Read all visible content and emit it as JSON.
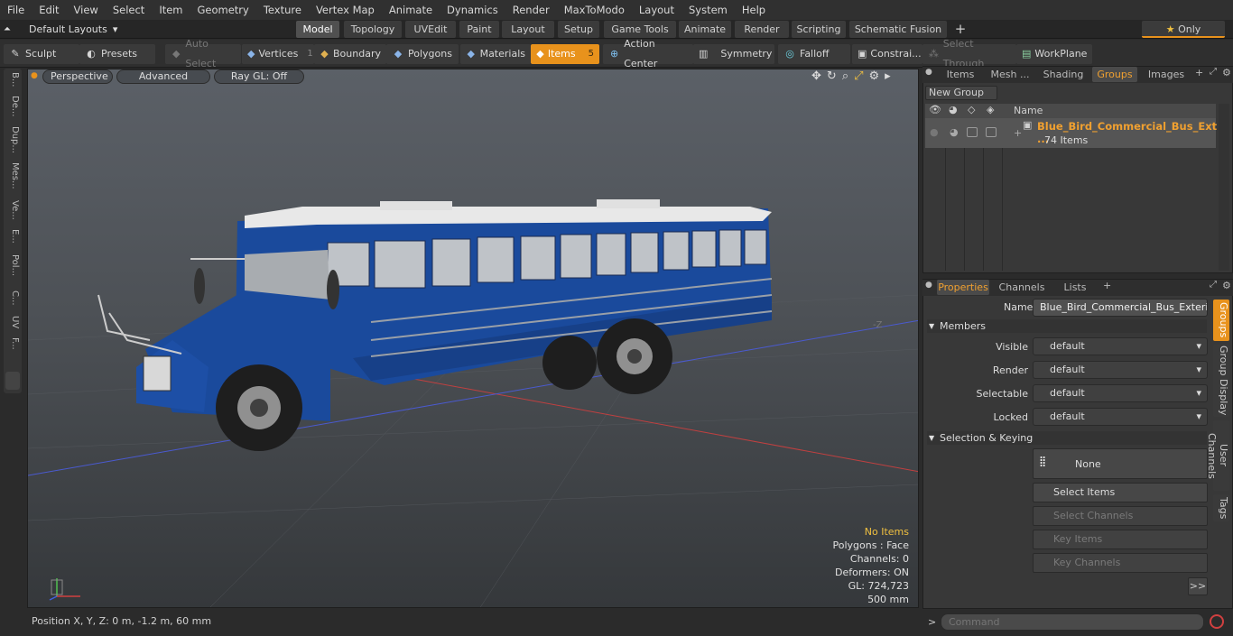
{
  "menu": [
    "File",
    "Edit",
    "View",
    "Select",
    "Item",
    "Geometry",
    "Texture",
    "Vertex Map",
    "Animate",
    "Dynamics",
    "Render",
    "MaxToModo",
    "Layout",
    "System",
    "Help"
  ],
  "tabbar": {
    "layouts_label": "Default Layouts",
    "tabs": [
      "Model",
      "Topology",
      "UVEdit",
      "Paint",
      "Layout",
      "Setup",
      "Game Tools",
      "Animate",
      "Render",
      "Scripting",
      "Schematic Fusion"
    ],
    "add": "+",
    "only_label": "Only"
  },
  "toolbar": {
    "sculpt": "Sculpt",
    "presets": "Presets",
    "auto_select": "Auto Select",
    "vertices": "Vertices",
    "vertices_count": "1",
    "boundary": "Boundary",
    "polygons": "Polygons",
    "materials": "Materials",
    "items": "Items",
    "items_count": "5",
    "action_center": "Action Center",
    "symmetry": "Symmetry",
    "falloff": "Falloff",
    "constraints": "Constrai...",
    "select_through": "Select Through",
    "workplane": "WorkPlane"
  },
  "lefttabs": [
    "B...",
    "De...",
    "Dup...",
    "Mes...",
    "Ve...",
    "E...",
    "Pol...",
    "C...",
    "UV",
    "F..."
  ],
  "viewport": {
    "perspective": "Perspective",
    "advanced": "Advanced",
    "raygl": "Ray GL: Off",
    "axis_label": "-Z",
    "stats": {
      "no_items": "No Items",
      "polygons": "Polygons : Face",
      "channels": "Channels: 0",
      "deformers": "Deformers: ON",
      "gl": "GL: 724,723",
      "scale": "500 mm"
    }
  },
  "statusbar": "Position X, Y, Z:   0 m, -1.2 m, 60 mm",
  "groups_panel": {
    "tabs": [
      "Items",
      "Mesh ...",
      "Shading",
      "Groups",
      "Images"
    ],
    "active_tab": "Groups",
    "new_group": "New Group",
    "name_header": "Name",
    "group_name": "Blue_Bird_Commercial_Bus_Ext ...",
    "group_count": "74 Items"
  },
  "properties_panel": {
    "tabs": [
      "Properties",
      "Channels",
      "Lists"
    ],
    "name_label": "Name",
    "name_value": "Blue_Bird_Commercial_Bus_Exterior_C",
    "members_section": "Members",
    "fields": [
      {
        "label": "Visible",
        "value": "default"
      },
      {
        "label": "Render",
        "value": "default"
      },
      {
        "label": "Selectable",
        "value": "default"
      },
      {
        "label": "Locked",
        "value": "default"
      }
    ],
    "selection_section": "Selection & Keying",
    "none_label": "None",
    "select_items": "Select Items",
    "select_channels": "Select Channels",
    "key_items": "Key Items",
    "key_channels": "Key Channels",
    "more": ">>"
  },
  "right_vtabs": [
    "Groups",
    "Group Display",
    "User Channels",
    "Tags"
  ],
  "command_placeholder": "Command",
  "colors": {
    "accent": "#e8921c",
    "bus_blue": "#1a4a9c",
    "viewport": "#4d5156"
  }
}
